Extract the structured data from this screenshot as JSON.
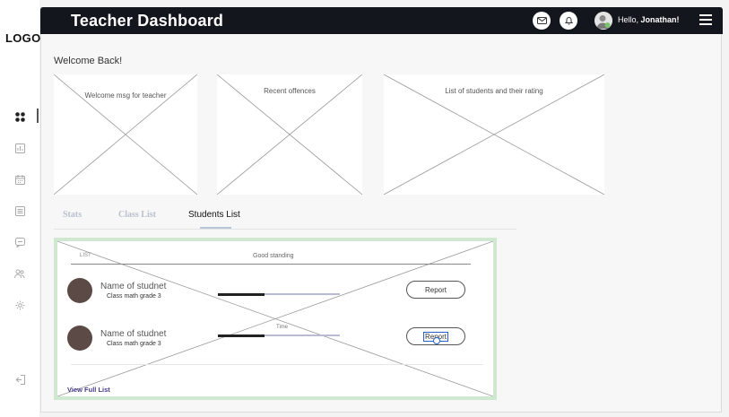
{
  "app": {
    "logo": "LOGO",
    "title": "Teacher Dashboard"
  },
  "header": {
    "greeting_prefix": "Hello, ",
    "user_name": "Jonathan!",
    "icons": [
      "mail-icon",
      "bell-icon",
      "avatar",
      "hamburger-menu-icon"
    ]
  },
  "sidebar": {
    "items": [
      {
        "icon": "dashboard-grid-icon",
        "active": true
      },
      {
        "icon": "bar-chart-icon",
        "active": false
      },
      {
        "icon": "calendar-icon",
        "active": false
      },
      {
        "icon": "list-icon",
        "active": false
      },
      {
        "icon": "chat-icon",
        "active": false
      },
      {
        "icon": "users-icon",
        "active": false
      },
      {
        "icon": "gear-icon",
        "active": false
      }
    ],
    "logout_icon": "logout-icon"
  },
  "main": {
    "welcome": "Welcome Back!",
    "cards": [
      {
        "label": "Welcome msg for teacher"
      },
      {
        "label": "Recent offences"
      },
      {
        "label": "List of students and their rating"
      }
    ],
    "tabs": [
      {
        "label": "Stats",
        "active": false
      },
      {
        "label": "Class List",
        "active": false
      },
      {
        "label": "Students List",
        "active": true
      }
    ],
    "student_list": {
      "column_list": "LIST",
      "column_standing": "Good standing",
      "time_label": "Time",
      "students": [
        {
          "name": "Name of studnet",
          "class": "Class math grade 3",
          "progress": 0.38,
          "action": "Report"
        },
        {
          "name": "Name of studnet",
          "class": "Class math grade 3",
          "progress": 0.38,
          "action": "Report"
        }
      ],
      "view_full_list": "View Full List"
    }
  },
  "colors": {
    "topbar": "#13161d",
    "card_border": "#cfe8cf",
    "link": "#4a3b86",
    "avatar": "#5b4a46",
    "tab_inactive": "#b9c0ce",
    "focus": "#2962c6"
  }
}
